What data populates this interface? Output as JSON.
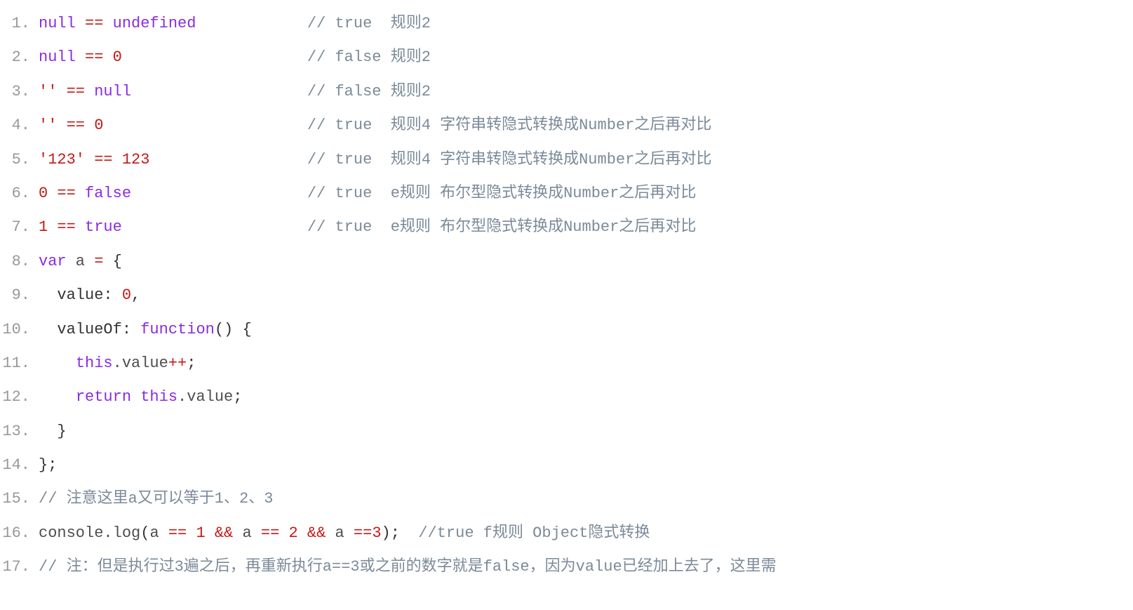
{
  "lines": [
    {
      "num": "1.",
      "tokens": [
        {
          "t": "null",
          "c": "kw-null"
        },
        {
          "t": " ",
          "c": ""
        },
        {
          "t": "==",
          "c": "op"
        },
        {
          "t": " ",
          "c": ""
        },
        {
          "t": "undefined",
          "c": "kw-undefined"
        },
        {
          "t": "            ",
          "c": ""
        },
        {
          "t": "// true  规则2",
          "c": "comment"
        }
      ]
    },
    {
      "num": "2.",
      "tokens": [
        {
          "t": "null",
          "c": "kw-null"
        },
        {
          "t": " ",
          "c": ""
        },
        {
          "t": "==",
          "c": "op"
        },
        {
          "t": " ",
          "c": ""
        },
        {
          "t": "0",
          "c": "num"
        },
        {
          "t": "                    ",
          "c": ""
        },
        {
          "t": "// false 规则2",
          "c": "comment"
        }
      ]
    },
    {
      "num": "3.",
      "tokens": [
        {
          "t": "''",
          "c": "str"
        },
        {
          "t": " ",
          "c": ""
        },
        {
          "t": "==",
          "c": "op"
        },
        {
          "t": " ",
          "c": ""
        },
        {
          "t": "null",
          "c": "kw-null"
        },
        {
          "t": "                   ",
          "c": ""
        },
        {
          "t": "// false 规则2",
          "c": "comment"
        }
      ]
    },
    {
      "num": "4.",
      "tokens": [
        {
          "t": "''",
          "c": "str"
        },
        {
          "t": " ",
          "c": ""
        },
        {
          "t": "==",
          "c": "op"
        },
        {
          "t": " ",
          "c": ""
        },
        {
          "t": "0",
          "c": "num"
        },
        {
          "t": "                      ",
          "c": ""
        },
        {
          "t": "// true  规则4 字符串转隐式转换成Number之后再对比",
          "c": "comment"
        }
      ]
    },
    {
      "num": "5.",
      "tokens": [
        {
          "t": "'123'",
          "c": "str"
        },
        {
          "t": " ",
          "c": ""
        },
        {
          "t": "==",
          "c": "op"
        },
        {
          "t": " ",
          "c": ""
        },
        {
          "t": "123",
          "c": "num"
        },
        {
          "t": "                 ",
          "c": ""
        },
        {
          "t": "// true  规则4 字符串转隐式转换成Number之后再对比",
          "c": "comment"
        }
      ]
    },
    {
      "num": "6.",
      "tokens": [
        {
          "t": "0",
          "c": "num"
        },
        {
          "t": " ",
          "c": ""
        },
        {
          "t": "==",
          "c": "op"
        },
        {
          "t": " ",
          "c": ""
        },
        {
          "t": "false",
          "c": "kw-false"
        },
        {
          "t": "                   ",
          "c": ""
        },
        {
          "t": "// true  e规则 布尔型隐式转换成Number之后再对比",
          "c": "comment"
        }
      ]
    },
    {
      "num": "7.",
      "tokens": [
        {
          "t": "1",
          "c": "num"
        },
        {
          "t": " ",
          "c": ""
        },
        {
          "t": "==",
          "c": "op"
        },
        {
          "t": " ",
          "c": ""
        },
        {
          "t": "true",
          "c": "kw-true"
        },
        {
          "t": "                    ",
          "c": ""
        },
        {
          "t": "// true  e规则 布尔型隐式转换成Number之后再对比",
          "c": "comment"
        }
      ]
    },
    {
      "num": "8.",
      "tokens": [
        {
          "t": "var",
          "c": "kw-var"
        },
        {
          "t": " a ",
          "c": "ident"
        },
        {
          "t": "=",
          "c": "op"
        },
        {
          "t": " ",
          "c": ""
        },
        {
          "t": "{",
          "c": "punct"
        }
      ]
    },
    {
      "num": "9.",
      "tokens": [
        {
          "t": "  value",
          "c": "obj-key"
        },
        {
          "t": ":",
          "c": "punct"
        },
        {
          "t": " ",
          "c": ""
        },
        {
          "t": "0",
          "c": "num"
        },
        {
          "t": ",",
          "c": "punct"
        }
      ]
    },
    {
      "num": "10.",
      "tokens": [
        {
          "t": "  valueOf",
          "c": "obj-key"
        },
        {
          "t": ":",
          "c": "punct"
        },
        {
          "t": " ",
          "c": ""
        },
        {
          "t": "function",
          "c": "kw-function"
        },
        {
          "t": "()",
          "c": "punct"
        },
        {
          "t": " ",
          "c": ""
        },
        {
          "t": "{",
          "c": "punct"
        }
      ]
    },
    {
      "num": "11.",
      "tokens": [
        {
          "t": "    ",
          "c": ""
        },
        {
          "t": "this",
          "c": "kw-this"
        },
        {
          "t": ".value",
          "c": "ident"
        },
        {
          "t": "++",
          "c": "op"
        },
        {
          "t": ";",
          "c": "punct"
        }
      ]
    },
    {
      "num": "12.",
      "tokens": [
        {
          "t": "    ",
          "c": ""
        },
        {
          "t": "return",
          "c": "kw-return"
        },
        {
          "t": " ",
          "c": ""
        },
        {
          "t": "this",
          "c": "kw-this"
        },
        {
          "t": ".value",
          "c": "ident"
        },
        {
          "t": ";",
          "c": "punct"
        }
      ]
    },
    {
      "num": "13.",
      "tokens": [
        {
          "t": "  }",
          "c": "punct"
        }
      ]
    },
    {
      "num": "14.",
      "tokens": [
        {
          "t": "};",
          "c": "punct"
        }
      ]
    },
    {
      "num": "15.",
      "tokens": [
        {
          "t": "// 注意这里a又可以等于1、2、3",
          "c": "comment"
        }
      ]
    },
    {
      "num": "16.",
      "tokens": [
        {
          "t": "console",
          "c": "console"
        },
        {
          "t": ".log",
          "c": "ident"
        },
        {
          "t": "(",
          "c": "punct"
        },
        {
          "t": "a ",
          "c": "ident"
        },
        {
          "t": "==",
          "c": "op"
        },
        {
          "t": " ",
          "c": ""
        },
        {
          "t": "1",
          "c": "num"
        },
        {
          "t": " ",
          "c": ""
        },
        {
          "t": "&&",
          "c": "op"
        },
        {
          "t": " a ",
          "c": "ident"
        },
        {
          "t": "==",
          "c": "op"
        },
        {
          "t": " ",
          "c": ""
        },
        {
          "t": "2",
          "c": "num"
        },
        {
          "t": " ",
          "c": ""
        },
        {
          "t": "&&",
          "c": "op"
        },
        {
          "t": " a ",
          "c": "ident"
        },
        {
          "t": "==",
          "c": "op"
        },
        {
          "t": "3",
          "c": "num"
        },
        {
          "t": ");",
          "c": "punct"
        },
        {
          "t": "  ",
          "c": ""
        },
        {
          "t": "//true f规则 Object隐式转换",
          "c": "comment"
        }
      ]
    },
    {
      "num": "17.",
      "tokens": [
        {
          "t": "// 注：但是执行过3遍之后，再重新执行a==3或之前的数字就是false，因为value已经加上去了，这里需",
          "c": "comment"
        }
      ]
    }
  ]
}
